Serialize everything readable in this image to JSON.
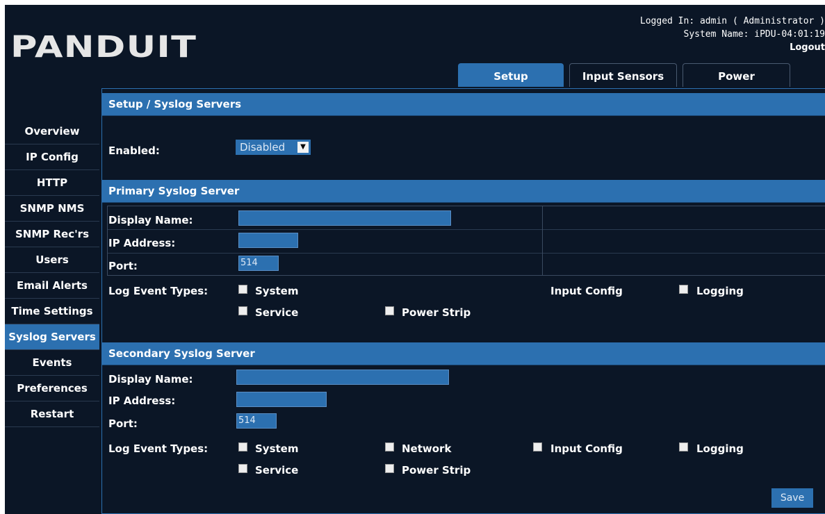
{
  "brand": {
    "logo": "PANDUIT"
  },
  "header": {
    "logged_in": "Logged In: admin ( Administrator )",
    "system_name": "System Name: iPDU-04:01:19",
    "logout": "Logout"
  },
  "tabs": [
    {
      "label": "Setup",
      "active": true
    },
    {
      "label": "Input Sensors",
      "active": false
    },
    {
      "label": "Power",
      "active": false
    }
  ],
  "sidebar": {
    "items": [
      {
        "label": "Overview"
      },
      {
        "label": "IP Config"
      },
      {
        "label": "HTTP"
      },
      {
        "label": "SNMP NMS"
      },
      {
        "label": "SNMP Rec'rs"
      },
      {
        "label": "Users"
      },
      {
        "label": "Email Alerts"
      },
      {
        "label": "Time Settings"
      },
      {
        "label": "Syslog Servers",
        "active": true
      },
      {
        "label": "Events"
      },
      {
        "label": "Preferences"
      },
      {
        "label": "Restart"
      }
    ]
  },
  "page": {
    "title": "Setup / Syslog Servers",
    "enabled_label": "Enabled:",
    "enabled_value": "Disabled"
  },
  "primary": {
    "title": "Primary Syslog Server",
    "display_name_label": "Display Name:",
    "display_name_value": "",
    "ip_label": "IP Address:",
    "ip_value": "",
    "port_label": "Port:",
    "port_value": "514",
    "log_types_label": "Log Event Types:",
    "types": {
      "system": "System",
      "input_config": "Input Config",
      "logging": "Logging",
      "service": "Service",
      "power_strip": "Power Strip"
    }
  },
  "secondary": {
    "title": "Secondary Syslog Server",
    "display_name_label": "Display Name:",
    "display_name_value": "",
    "ip_label": "IP Address:",
    "ip_value": "",
    "port_label": "Port:",
    "port_value": "514",
    "log_types_label": "Log Event Types:",
    "types": {
      "system": "System",
      "network": "Network",
      "input_config": "Input Config",
      "logging": "Logging",
      "service": "Service",
      "power_strip": "Power Strip"
    }
  },
  "actions": {
    "save": "Save"
  },
  "colors": {
    "background": "#0b1626",
    "accent": "#2c70b0"
  }
}
